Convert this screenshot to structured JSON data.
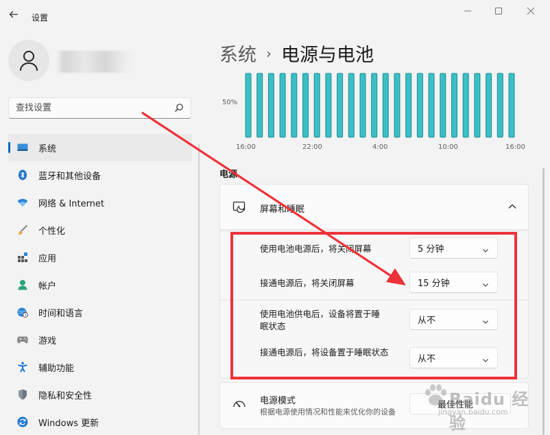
{
  "window": {
    "title": "设置",
    "controls": [
      "minimize",
      "maximize",
      "close"
    ]
  },
  "search": {
    "placeholder": "查找设置"
  },
  "sidebar": {
    "items": [
      {
        "label": "系统",
        "icon": "system-icon",
        "active": true
      },
      {
        "label": "蓝牙和其他设备",
        "icon": "bluetooth-icon"
      },
      {
        "label": "网络 & Internet",
        "icon": "wifi-icon"
      },
      {
        "label": "个性化",
        "icon": "brush-icon"
      },
      {
        "label": "应用",
        "icon": "apps-icon"
      },
      {
        "label": "帐户",
        "icon": "account-icon"
      },
      {
        "label": "时间和语言",
        "icon": "globe-clock-icon"
      },
      {
        "label": "游戏",
        "icon": "gamepad-icon"
      },
      {
        "label": "辅助功能",
        "icon": "accessibility-icon"
      },
      {
        "label": "隐私和安全性",
        "icon": "shield-icon"
      },
      {
        "label": "Windows 更新",
        "icon": "update-icon"
      }
    ]
  },
  "breadcrumb": {
    "parent": "系统",
    "separator": "›",
    "current": "电源与电池"
  },
  "chart_data": {
    "type": "bar",
    "ytick_label": "50%",
    "xtick_labels": [
      "16:00",
      "22:00",
      "4:00",
      "10:00",
      "16:00"
    ],
    "bar_count": 24,
    "values": [
      100,
      100,
      100,
      100,
      100,
      100,
      100,
      100,
      100,
      100,
      100,
      100,
      100,
      100,
      100,
      100,
      100,
      100,
      100,
      100,
      100,
      100,
      100,
      100
    ],
    "bar_color": "#3bbfc6",
    "bar_edge_color": "#1f8c93"
  },
  "power": {
    "section_title": "电源",
    "screen_sleep": {
      "title": "屏幕和睡眠",
      "rows": [
        {
          "label": "使用电池电源后，将关闭屏幕",
          "value": "5 分钟"
        },
        {
          "label": "接通电源后，将关闭屏幕",
          "value": "15 分钟"
        },
        {
          "label": "使用电池供电后，设备将置于睡眠状态",
          "value": "从不"
        },
        {
          "label": "接通电源后，将设备置于睡眠状态",
          "value": "从不"
        }
      ]
    },
    "power_mode": {
      "title": "电源模式",
      "description": "根据电源使用情况和性能来优化你的设备",
      "value": "最佳性能"
    }
  },
  "annotation": {
    "color": "#ee3138"
  },
  "watermark": {
    "text": "Baidu 经验",
    "url_text": "jingyan.baidu.com"
  }
}
